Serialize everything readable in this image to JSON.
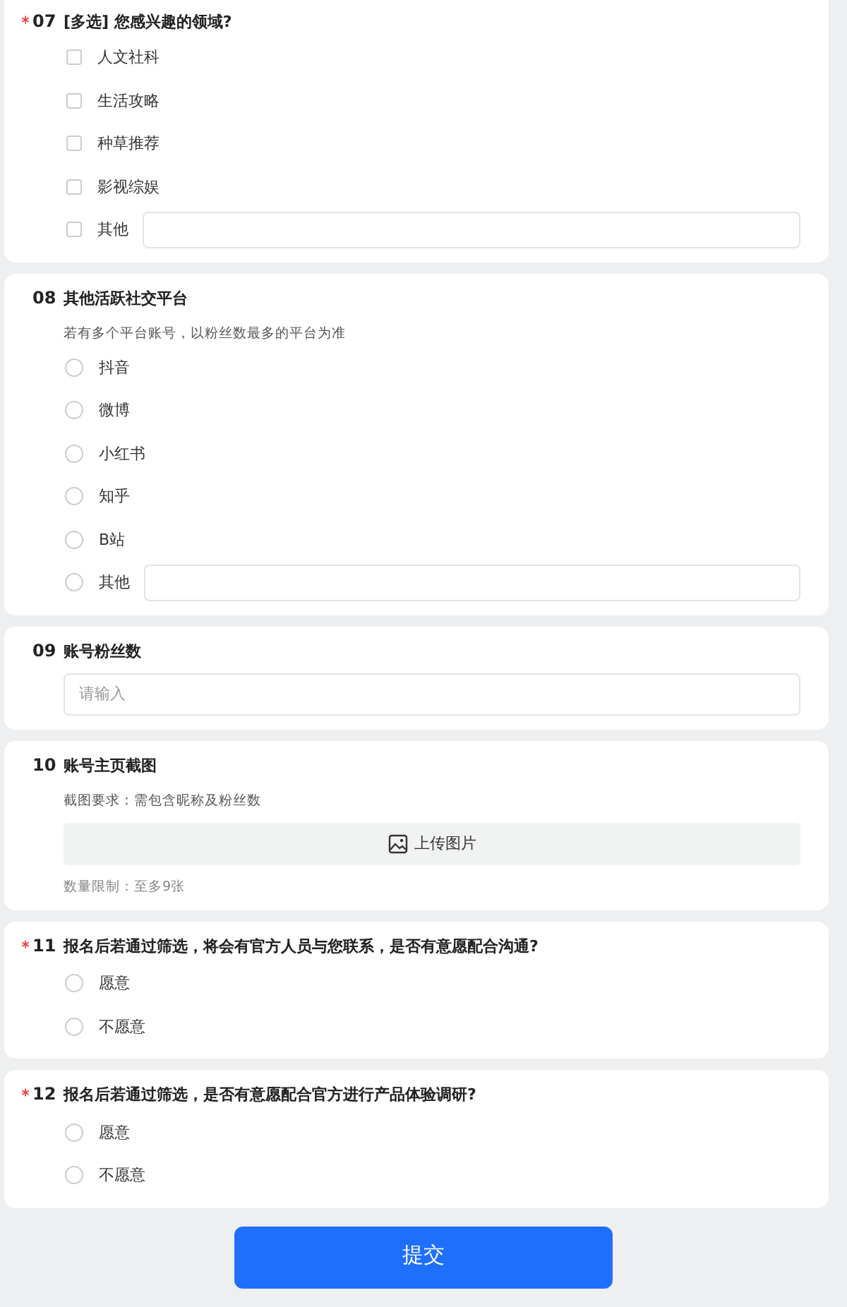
{
  "questions": [
    {
      "number": "07",
      "title": "[多选] 您感兴趣的领域?",
      "required": true,
      "kind": "checkbox",
      "options": [
        {
          "label": "人文社科",
          "checked": false,
          "kind": "plain"
        },
        {
          "label": "生活攻略",
          "checked": false,
          "kind": "plain"
        },
        {
          "label": "种草推荐",
          "checked": false,
          "kind": "plain"
        },
        {
          "label": "影视综娱",
          "checked": false,
          "kind": "plain"
        },
        {
          "label": "其他",
          "checked": false,
          "kind": "with_field"
        }
      ]
    },
    {
      "number": "08",
      "title": "其他活跃社交平台",
      "required": false,
      "kind": "radio",
      "hint": "若有多个平台账号，以粉丝数最多的平台为准",
      "options": [
        {
          "label": "抖音",
          "selected": false,
          "kind": "plain"
        },
        {
          "label": "微博",
          "selected": false,
          "kind": "plain"
        },
        {
          "label": "小红书",
          "selected": false,
          "kind": "plain"
        },
        {
          "label": "知乎",
          "selected": false,
          "kind": "plain"
        },
        {
          "label": "B站",
          "selected": false,
          "kind": "plain"
        },
        {
          "label": "其他",
          "selected": false,
          "kind": "with_field"
        }
      ]
    },
    {
      "number": "09",
      "title": "账号粉丝数",
      "required": false,
      "kind": "text",
      "placeholder": "请输入"
    },
    {
      "number": "10",
      "title": "账号主页截图",
      "required": false,
      "kind": "upload",
      "hint": "截图要求：需包含昵称及粉丝数",
      "button": "上传图片",
      "note": "数量限制：至多9张"
    },
    {
      "number": "11",
      "title": "报名后若通过筛选，将会有官方人员与您联系，是否有意愿配合沟通?",
      "required": true,
      "kind": "radio",
      "options": [
        {
          "label": "愿意",
          "selected": false,
          "kind": "plain"
        },
        {
          "label": "不愿意",
          "selected": false,
          "kind": "plain"
        }
      ]
    },
    {
      "number": "12",
      "title": "报名后若通过筛选，是否有意愿配合官方进行产品体验调研?",
      "required": true,
      "kind": "radio",
      "options": [
        {
          "label": "愿意",
          "selected": false,
          "kind": "plain"
        },
        {
          "label": "不愿意",
          "selected": false,
          "kind": "plain"
        }
      ]
    }
  ],
  "submit": "提交"
}
